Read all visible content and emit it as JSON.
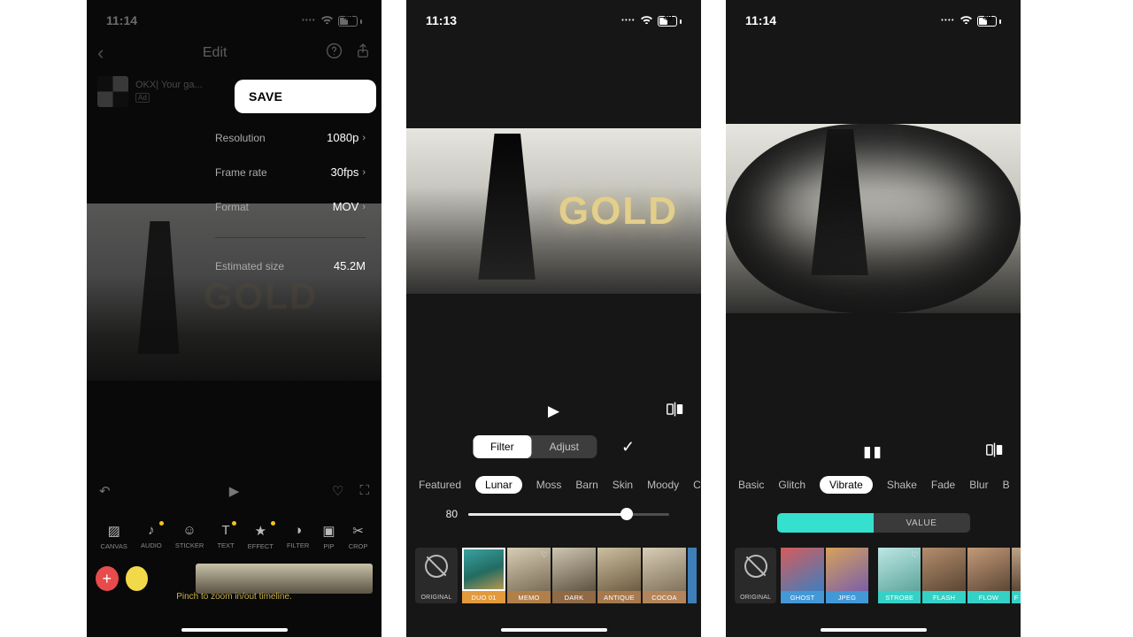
{
  "statusbar": {
    "battery": "49"
  },
  "panel1": {
    "time": "11:14",
    "title": "Edit",
    "ad_title": "OKX| Your ga...",
    "ad_tag": "Ad",
    "save": "SAVE",
    "rows": [
      {
        "label": "Resolution",
        "value": "1080p"
      },
      {
        "label": "Frame rate",
        "value": "30fps"
      },
      {
        "label": "Format",
        "value": "MOV"
      },
      {
        "label": "Estimated size",
        "value": "45.2M"
      }
    ],
    "gold": "GOLD",
    "toolbar": [
      "CANVAS",
      "AUDIO",
      "STICKER",
      "TEXT",
      "EFFECT",
      "FILTER",
      "PIP",
      "CROP"
    ],
    "hint": "Pinch to zoom in/out timeline."
  },
  "panel2": {
    "time": "11:13",
    "gold": "GOLD",
    "seg": {
      "filter": "Filter",
      "adjust": "Adjust"
    },
    "active_cat": "Lunar",
    "cats": [
      "Featured",
      "Lunar",
      "Moss",
      "Barn",
      "Skin",
      "Moody",
      "Cream"
    ],
    "slider_value": "80",
    "original": "ORIGINAL",
    "filters": [
      {
        "name": "DUO 01",
        "color": "#e29a3c",
        "img": "linear-gradient(160deg,#3aa5a5 0%,#236b62 55%,#c69b4d 100%)",
        "selected": true
      },
      {
        "name": "MEMO",
        "color": "#b17f4a",
        "img": "linear-gradient(160deg,#d7cdb6,#7b6d55)"
      },
      {
        "name": "DARK",
        "color": "#8f6a45",
        "img": "linear-gradient(160deg,#cfc6b2,#5d523f)"
      },
      {
        "name": "ANTIQUE",
        "color": "#a67a4e",
        "img": "linear-gradient(160deg,#cdbfa1,#6c5b41)"
      },
      {
        "name": "COCOA",
        "color": "#b4855a",
        "img": "linear-gradient(160deg,#d8cdb6,#80715a)"
      }
    ]
  },
  "panel3": {
    "time": "11:14",
    "active_cat": "Vibrate",
    "cats": [
      "Basic",
      "Glitch",
      "Vibrate",
      "Shake",
      "Fade",
      "Blur",
      "B"
    ],
    "value_label": "VALUE",
    "original": "ORIGINAL",
    "effects_group1": [
      {
        "name": "GHOST",
        "color": "#4398d6",
        "img": "linear-gradient(150deg,#d65b5b,#3e7fbf)"
      },
      {
        "name": "JPEG",
        "color": "#4398d6",
        "img": "linear-gradient(150deg,#d7a25b,#7a5fa8)"
      }
    ],
    "effects_group2": [
      {
        "name": "STROBE",
        "color": "#35d0c6",
        "img": "linear-gradient(155deg,#bde7e3,#5da59d)",
        "heart": true
      },
      {
        "name": "FLASH",
        "color": "#35d0c6",
        "img": "linear-gradient(155deg,#b48e6c,#5a4534)"
      },
      {
        "name": "FLOW",
        "color": "#35d0c6",
        "img": "linear-gradient(155deg,#c49a78,#5d4736)"
      }
    ]
  }
}
